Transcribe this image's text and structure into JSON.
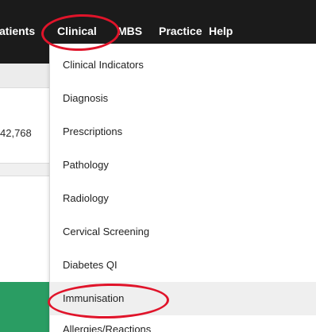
{
  "navbar": {
    "items": [
      {
        "label": "atients"
      },
      {
        "label": "Clinical"
      },
      {
        "label": "MBS"
      },
      {
        "label": "Practice"
      },
      {
        "label": "Help"
      }
    ]
  },
  "background": {
    "number_text": "42,768"
  },
  "dropdown": {
    "items": [
      {
        "label": "Clinical Indicators"
      },
      {
        "label": "Diagnosis"
      },
      {
        "label": "Prescriptions"
      },
      {
        "label": "Pathology"
      },
      {
        "label": "Radiology"
      },
      {
        "label": "Cervical Screening"
      },
      {
        "label": "Diabetes QI"
      },
      {
        "label": "Immunisation",
        "highlighted": true
      },
      {
        "label": "Allergies/Reactions"
      }
    ]
  },
  "colors": {
    "navbar_bg": "#1b1b1b",
    "annotation_red": "#e0142a",
    "active_row_bg": "#efefef",
    "accent_green": "#2a9d63"
  }
}
